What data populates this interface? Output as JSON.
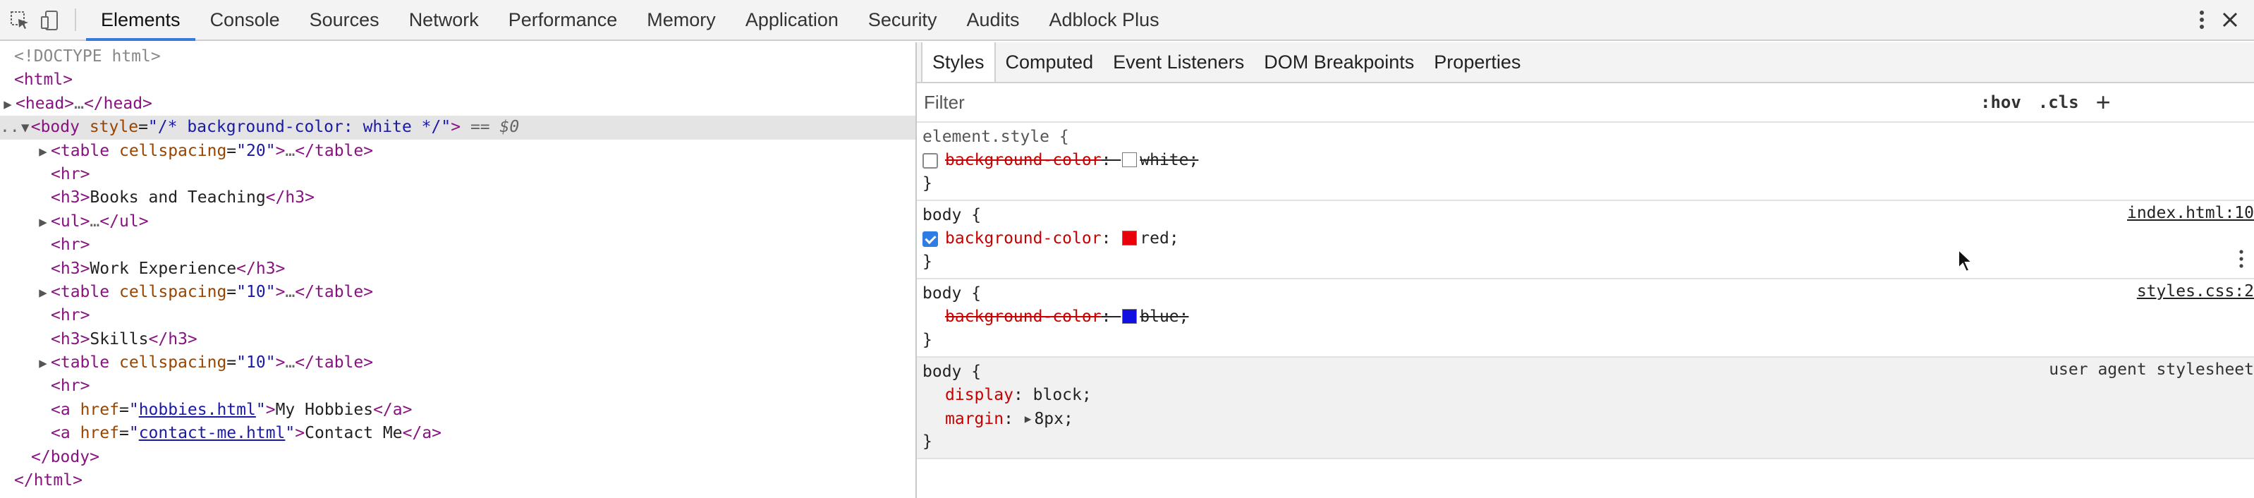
{
  "toolbar": {
    "tabs": [
      {
        "label": "Elements",
        "active": true
      },
      {
        "label": "Console"
      },
      {
        "label": "Sources"
      },
      {
        "label": "Network"
      },
      {
        "label": "Performance"
      },
      {
        "label": "Memory"
      },
      {
        "label": "Application"
      },
      {
        "label": "Security"
      },
      {
        "label": "Audits"
      },
      {
        "label": "Adblock Plus"
      }
    ],
    "icons": [
      "inspect-element-icon",
      "device-toolbar-icon",
      "kebab-menu-icon",
      "close-icon"
    ]
  },
  "dom": {
    "doctype": "<!DOCTYPE html>",
    "html_open": "<html>",
    "head": {
      "open": "<head>",
      "ellipsis": "…",
      "close": "</head>"
    },
    "body": {
      "tag": "body",
      "attr": "style",
      "value": "/* background-color: white */",
      "marker": "== $0",
      "prefix": ".."
    },
    "children": [
      {
        "tag": "table",
        "attr": "cellspacing",
        "value": "20",
        "collapsed": true
      },
      {
        "tag": "hr"
      },
      {
        "tag": "h3",
        "text": "Books and Teaching"
      },
      {
        "tag": "ul",
        "collapsed": true
      },
      {
        "tag": "hr"
      },
      {
        "tag": "h3",
        "text": "Work Experience"
      },
      {
        "tag": "table",
        "attr": "cellspacing",
        "value": "10",
        "collapsed": true
      },
      {
        "tag": "hr"
      },
      {
        "tag": "h3",
        "text": "Skills"
      },
      {
        "tag": "table",
        "attr": "cellspacing",
        "value": "10",
        "collapsed": true
      },
      {
        "tag": "hr"
      },
      {
        "tag": "a",
        "attr": "href",
        "value": "hobbies.html",
        "text": "My Hobbies"
      },
      {
        "tag": "a",
        "attr": "href",
        "value": "contact-me.html",
        "text": "Contact Me"
      }
    ],
    "body_close": "</body>",
    "html_close": "</html>"
  },
  "styles_panel": {
    "subtabs": [
      "Styles",
      "Computed",
      "Event Listeners",
      "DOM Breakpoints",
      "Properties"
    ],
    "active_subtab": "Styles",
    "filter_placeholder": "Filter",
    "hov": ":hov",
    "cls": ".cls",
    "plus": "+",
    "rules": [
      {
        "selector": "element.style {",
        "close": "}",
        "source": "",
        "decls": [
          {
            "prop": "background-color",
            "value": "white",
            "swatch": "#ffffff",
            "checked": false,
            "struck": true
          }
        ]
      },
      {
        "selector": "body {",
        "close": "}",
        "source": "index.html:10",
        "decls": [
          {
            "prop": "background-color",
            "value": "red",
            "swatch": "#e8000b",
            "checked": true,
            "struck": false
          }
        ]
      },
      {
        "selector": "body {",
        "close": "}",
        "source": "styles.css:2",
        "decls": [
          {
            "prop": "background-color",
            "value": "blue",
            "swatch": "#1010e0",
            "checked": null,
            "struck": true
          }
        ]
      },
      {
        "selector": "body {",
        "close": "}",
        "source": "user agent stylesheet",
        "decls": [
          {
            "prop": "display",
            "value": "block"
          },
          {
            "prop": "margin",
            "value": "8px",
            "expandable": true
          }
        ]
      }
    ]
  },
  "colors": {
    "active_tab_underline": "#3879d9",
    "selected_row": "#e4e4e4",
    "tag": "#881280",
    "attr_name": "#994500",
    "attr_value": "#1a1aa6",
    "css_prop": "#c80000"
  }
}
